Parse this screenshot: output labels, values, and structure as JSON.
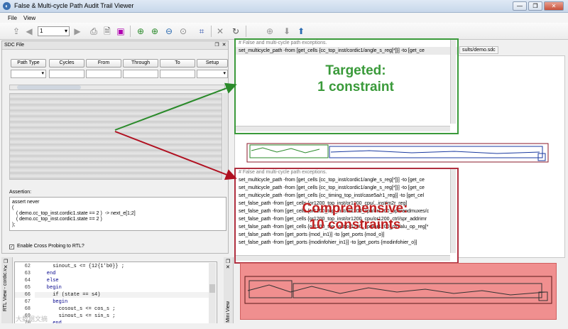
{
  "window": {
    "title": "False & Multi-cycle Path Audit Trail Viewer",
    "minimize": "—",
    "maximize": "❐",
    "close": "✕"
  },
  "menu": [
    "File",
    "View"
  ],
  "toolbar": {
    "page_value": "1",
    "combo_arrow": "▾"
  },
  "sdc_panel": {
    "title": "SDC File",
    "columns": [
      "Path Type",
      "Cycles",
      "From",
      "Through",
      "To",
      "Setup"
    ],
    "assertion_label": "Assertion:",
    "assertion_lines": [
      "assert never",
      "(",
      "   ( demo.cc_top_inst.cordic1.state == 2 )  -> next_e[1;2]",
      "   ( demo.cc_top_inst.cordic1.state == 2 )",
      ");"
    ],
    "cross_probe_label": "Enable Cross Probing to RTL?",
    "cross_probe_mark": "✓"
  },
  "rtl_panel": {
    "side_label": "RTL View - cordic.v",
    "lines": [
      {
        "num": "62",
        "code": "      sinout_s <= {12{1'b0}} ;"
      },
      {
        "num": "63",
        "code": "    end"
      },
      {
        "num": "64",
        "code": "    else"
      },
      {
        "num": "65",
        "code": "    begin"
      },
      {
        "num": "66",
        "code": "      if (state == s4)"
      },
      {
        "num": "67",
        "code": "      begin"
      },
      {
        "num": "68",
        "code": "        cosout_s <= cos_s ;"
      },
      {
        "num": "69",
        "code": "        sinout_s <= sin_s ;"
      },
      {
        "num": "70",
        "code": "      end"
      }
    ],
    "watermark": "大数据文摘"
  },
  "mini_view": {
    "side_label": "Mini View"
  },
  "tab": {
    "label": "sults/demo.sdc"
  },
  "targeted": {
    "header": "# False and multi-cycle path exceptions.",
    "lines": [
      "set_multicycle_path -from [get_cells {cc_top_inst/cordic1/angle_s_reg[*]}] -to [get_ce"
    ],
    "annotation_line1": "Targeted:",
    "annotation_line2": "1 constraint"
  },
  "comprehensive": {
    "header": "# False and multi-cycle path exceptions.",
    "lines": [
      "set_multicycle_path -from [get_cells {cc_top_inst/cordic1/angle_s_reg[*]}] -to [get_ce",
      "set_multicycle_path -from [get_cells {cc_top_inst/cordic1/angle_s_reg[*]}] -to [get_ce",
      "set_multicycle_path -from [get_cells {cc_timing_top_inst/case5a/r1_reg}] -to [get_cel",
      "set_false_path -from [get_cells {or1200_top_inst/or1200_cpu/...inst/m2r_reg]",
      "set_false_path -from [get_cells {or1200_top_inst/or1200_cpu/or1200_operandmuxes/c",
      "set_false_path -from [get_cells {or1200_top_inst/or1200_cpu/or1200_ctrl/spr_addrimr",
      "set_false_path -from [get_cells {or1200_top_inst/or1200_cpu/or1200_ctrl/alu_op_reg[*",
      "set_false_path -from [get_ports {mod_in1}] -to [get_ports {mod_o}]",
      "set_false_path -from [get_ports {modinfohier_in1}] -to [get_ports {modinfohier_o}]"
    ],
    "annotation_line1": "Comprehensive:",
    "annotation_line2": "10 constraints"
  },
  "colors": {
    "targeted_green": "#3b9a3b",
    "comprehensive_red": "#b03040",
    "mini_view_fill": "#f08f8f"
  },
  "icons": [
    "upload-icon",
    "back-icon",
    "forward-icon",
    "print-icon",
    "print-preview-icon",
    "export-icon",
    "zoom-fit-icon",
    "zoom-in-icon",
    "zoom-out-icon",
    "zoom-area-icon",
    "schematic-icon",
    "delete-icon",
    "redo-icon",
    "add-icon",
    "down-arrow-icon",
    "up-arrow-icon"
  ]
}
